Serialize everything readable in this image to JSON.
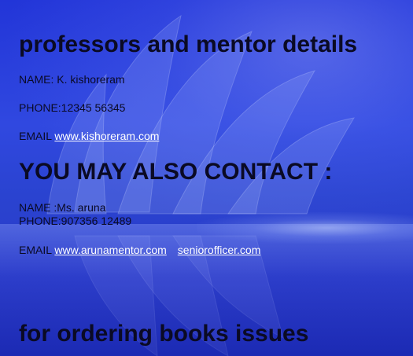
{
  "sections": {
    "professors": {
      "heading": "professors and mentor details",
      "name_line": "NAME: K. kishoreram",
      "phone_line": "PHONE:12345 56345",
      "email_label": "EMAIL",
      "email_link": "www.kishoreram.com"
    },
    "contact": {
      "heading": "YOU MAY ALSO CONTACT :",
      "name_line": "NAME :Ms. aruna",
      "phone_line": "PHONE:907356 12489",
      "email_label": "EMAIL",
      "email_link_1": "www.arunamentor.com",
      "email_link_2": "seniorofficer.com"
    },
    "orders": {
      "heading": "for ordering books issues"
    }
  },
  "colors": {
    "background": "#2f3fd6",
    "text": "#0a0a24",
    "link": "#ffffff"
  }
}
